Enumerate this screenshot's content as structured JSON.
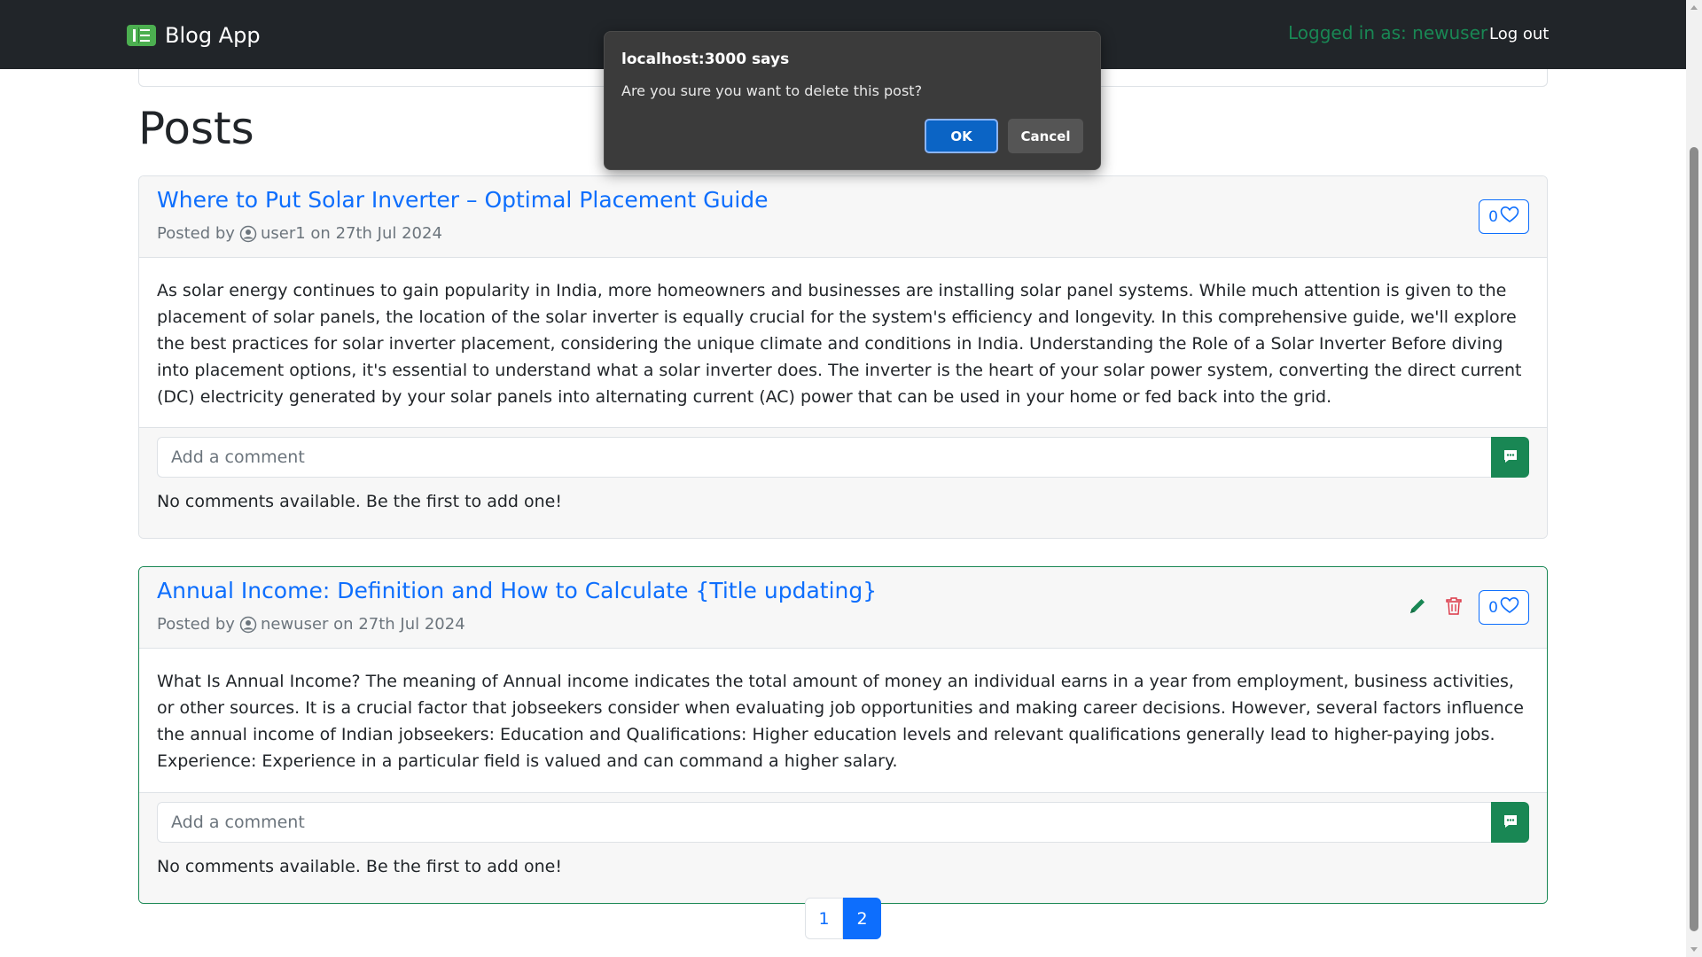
{
  "navbar": {
    "brand": "Blog App",
    "logged_in_text": "Logged in as: newuser",
    "logout_label": "Log out"
  },
  "page": {
    "heading": "Posts"
  },
  "posts": [
    {
      "title": "Where to Put Solar Inverter – Optimal Placement Guide",
      "posted_by_prefix": "Posted by",
      "author": "user1",
      "date_text": "on 27th Jul 2024",
      "likes": "0",
      "body": "As solar energy continues to gain popularity in India, more homeowners and businesses are installing solar panel systems. While much attention is given to the placement of solar panels, the location of the solar inverter is equally crucial for the system's efficiency and longevity. In this comprehensive guide, we'll explore the best practices for solar inverter placement, considering the unique climate and conditions in India. Understanding the Role of a Solar Inverter Before diving into placement options, it's essential to understand what a solar inverter does. The inverter is the heart of your solar power system, converting the direct current (DC) electricity generated by your solar panels into alternating current (AC) power that can be used in your home or fed back into the grid.",
      "comment_placeholder": "Add a comment",
      "no_comments_text": "No comments available. Be the first to add one!"
    },
    {
      "title": "Annual Income: Definition and How to Calculate {Title updating}",
      "posted_by_prefix": "Posted by",
      "author": "newuser",
      "date_text": "on 27th Jul 2024",
      "likes": "0",
      "body": "What Is Annual Income? The meaning of Annual income indicates the total amount of money an individual earns in a year from employment, business activities, or other sources. It is a crucial factor that jobseekers consider when evaluating job opportunities and making career decisions. However, several factors influence the annual income of Indian jobseekers: Education and Qualifications: Higher education levels and relevant qualifications generally lead to higher-paying jobs. Experience: Experience in a particular field is valued and can command a higher salary.",
      "comment_placeholder": "Add a comment",
      "no_comments_text": "No comments available. Be the first to add one!"
    }
  ],
  "pagination": {
    "pages": [
      "1",
      "2"
    ],
    "current": "2"
  },
  "dialog": {
    "title": "localhost:3000 says",
    "message": "Are you sure you want to delete this post?",
    "ok_label": "OK",
    "cancel_label": "Cancel"
  },
  "colors": {
    "navbar_bg": "#212529",
    "link_blue": "#0d6efd",
    "success_green": "#198754",
    "danger_red": "#dc3545"
  },
  "icons": {
    "brand": "book-icon",
    "author": "person-circle-icon",
    "like": "heart-outline-icon",
    "edit": "pencil-icon",
    "delete": "trash-icon",
    "send_comment": "chat-dots-icon"
  }
}
